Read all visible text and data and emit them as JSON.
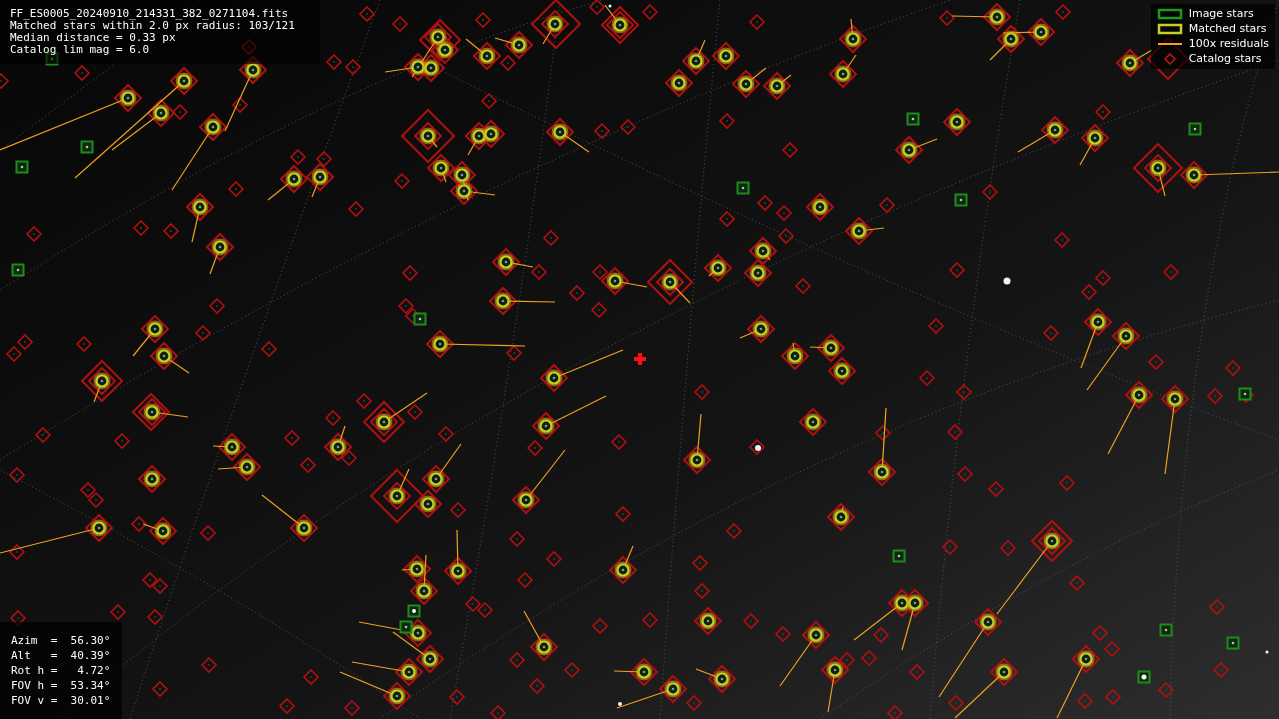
{
  "header": {
    "lines": [
      "FF_ES0005_20240910_214331_382_0271104.fits",
      "Matched stars within 2.0 px radius: 103/121",
      "Median distance = 0.33 px",
      "Catalog lim mag = 6.0"
    ]
  },
  "legend": [
    {
      "label": "Image stars",
      "kind": "image",
      "color": "#1f9a1f"
    },
    {
      "label": "Matched stars",
      "kind": "matched",
      "color": "#c8d21e"
    },
    {
      "label": "100x residuals",
      "kind": "residual",
      "color": "#f0a020"
    },
    {
      "label": "Catalog stars",
      "kind": "catalog",
      "color": "#c81414"
    }
  ],
  "pointing": {
    "lines": [
      "Azim  =  56.30°",
      "Alt   =  40.39°",
      "Rot h =   4.72°",
      "FOV h =  53.34°",
      "FOV v =  30.01°"
    ]
  }
}
